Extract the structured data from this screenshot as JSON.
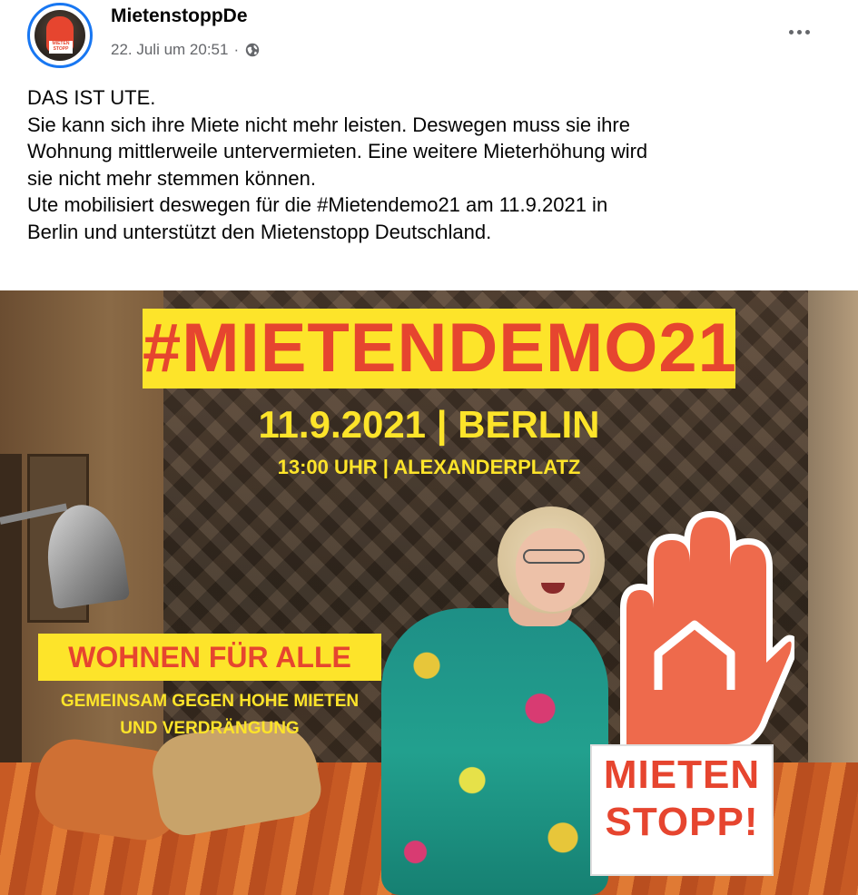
{
  "post": {
    "page_name": "MietenstoppDe",
    "timestamp": "22. Juli um 20:51",
    "separator": "·",
    "privacy_icon": "globe-icon",
    "more_icon": "more-options-icon",
    "avatar_text": "MIETEN STOPP",
    "text_lines": [
      "DAS IST UTE.",
      "Sie kann sich ihre Miete nicht mehr leisten. Deswegen muss sie ihre",
      "Wohnung mittlerweile untervermieten. Eine weitere Mieterhöhung wird",
      "sie nicht mehr stemmen können.",
      "Ute mobilisiert deswegen für die #Mietendemo21 am 11.9.2021 in",
      "Berlin und unterstützt den Mietenstopp Deutschland."
    ]
  },
  "poster": {
    "title": "#MIETENDEMO21",
    "date_place": "11.9.2021 | BERLIN",
    "time_place": "13:00 UHR | ALEXANDERPLATZ",
    "slogan": "WOHNEN FÜR ALLE",
    "subslogan_line1": "GEMEINSAM GEGEN HOHE MIETEN",
    "subslogan_line2": "UND VERDRÄNGUNG",
    "sign_line1": "MIETEN",
    "sign_line2": "STOPP!",
    "colors": {
      "yellow": "#fde42a",
      "red": "#e6452f"
    }
  }
}
